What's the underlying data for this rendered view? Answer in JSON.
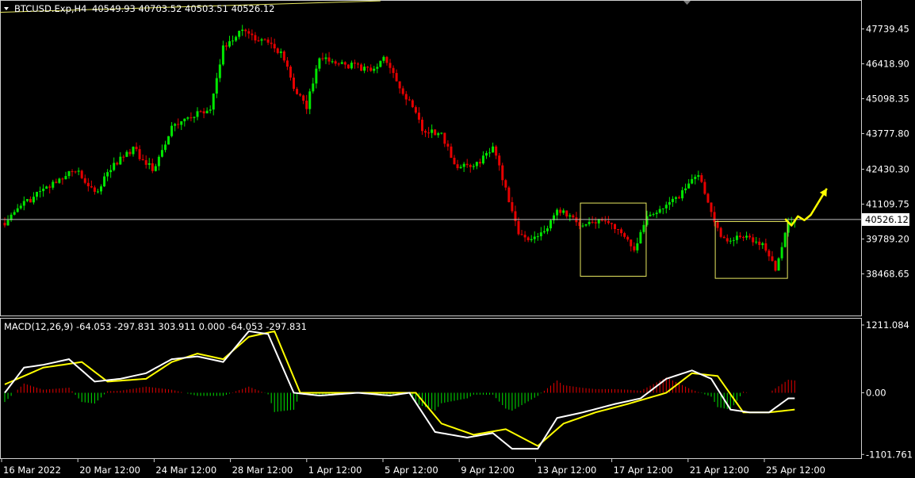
{
  "header": {
    "symbol_label": "BTCUSD.Exp,H4",
    "ohlc_label": "40549.93 40703.52 40503.51 40526.12"
  },
  "macd_header": {
    "label": "MACD(12,26,9) -64.053 -297.831 303.911 0.000 -64.053 -297.831"
  },
  "colors": {
    "background": "#000000",
    "bull_candle": "#00e600",
    "bear_candle": "#e60000",
    "macd_line": "#ffffff",
    "signal_line": "#ffff00",
    "trendline": "#e8e860",
    "current_price_line": "#c0c0c0",
    "box": "#e8e860",
    "arrow": "#ffff00"
  },
  "chart_data": [
    {
      "type": "candlestick",
      "timeframe": "H4",
      "y_ticks": [
        "47739.45",
        "46418.90",
        "45098.35",
        "43777.80",
        "42430.30",
        "41109.75",
        "39789.20",
        "38468.65"
      ],
      "y_tick_values": [
        47739.45,
        46418.9,
        45098.35,
        43777.8,
        42430.3,
        41109.75,
        39789.2,
        38468.65
      ],
      "current_price_label": "40526.12",
      "current_price": 40526.12,
      "ylim": [
        38000,
        48500
      ],
      "x_ticks": [
        "16 Mar 2022",
        "20 Mar 12:00",
        "24 Mar 12:00",
        "28 Mar 12:00",
        "1 Apr 12:00",
        "5 Apr 12:00",
        "9 Apr 12:00",
        "13 Apr 12:00",
        "17 Apr 12:00",
        "21 Apr 12:00",
        "25 Apr 12:00"
      ],
      "anchors": [
        [
          0,
          40400
        ],
        [
          4,
          40900
        ],
        [
          10,
          41500
        ],
        [
          16,
          42000
        ],
        [
          22,
          42400
        ],
        [
          28,
          41500
        ],
        [
          34,
          42600
        ],
        [
          40,
          43200
        ],
        [
          46,
          42400
        ],
        [
          52,
          44000
        ],
        [
          58,
          44400
        ],
        [
          64,
          44700
        ],
        [
          68,
          47000
        ],
        [
          74,
          47700
        ],
        [
          80,
          47300
        ],
        [
          86,
          46800
        ],
        [
          90,
          45600
        ],
        [
          94,
          44800
        ],
        [
          98,
          46600
        ],
        [
          104,
          46400
        ],
        [
          110,
          46300
        ],
        [
          114,
          46100
        ],
        [
          118,
          46700
        ],
        [
          122,
          45700
        ],
        [
          126,
          45000
        ],
        [
          130,
          43900
        ],
        [
          136,
          43800
        ],
        [
          140,
          42600
        ],
        [
          144,
          42500
        ],
        [
          148,
          42700
        ],
        [
          152,
          43200
        ],
        [
          156,
          41700
        ],
        [
          160,
          40000
        ],
        [
          164,
          39700
        ],
        [
          168,
          40000
        ],
        [
          172,
          41000
        ],
        [
          176,
          40600
        ],
        [
          180,
          40200
        ],
        [
          184,
          40500
        ],
        [
          188,
          40300
        ],
        [
          192,
          40100
        ],
        [
          196,
          39400
        ],
        [
          200,
          40600
        ],
        [
          204,
          40900
        ],
        [
          208,
          41200
        ],
        [
          212,
          41700
        ],
        [
          216,
          42300
        ],
        [
          220,
          40700
        ],
        [
          224,
          39700
        ],
        [
          228,
          39900
        ],
        [
          232,
          39800
        ],
        [
          236,
          39600
        ],
        [
          240,
          38700
        ],
        [
          244,
          40400
        ],
        [
          246,
          40526
        ]
      ]
    },
    {
      "type": "macd",
      "params": "12,26,9",
      "y_ticks": [
        "1211.084",
        "0.00",
        "-1101.761"
      ],
      "y_tick_values": [
        1211.084,
        0,
        -1101.761
      ],
      "ylim": [
        -1101.761,
        1211.084
      ],
      "macd_line_anchors": [
        [
          0,
          0
        ],
        [
          6,
          450
        ],
        [
          12,
          500
        ],
        [
          20,
          600
        ],
        [
          28,
          200
        ],
        [
          36,
          250
        ],
        [
          44,
          350
        ],
        [
          52,
          600
        ],
        [
          60,
          650
        ],
        [
          68,
          550
        ],
        [
          76,
          1100
        ],
        [
          82,
          1050
        ],
        [
          90,
          0
        ],
        [
          98,
          -50
        ],
        [
          110,
          0
        ],
        [
          120,
          -50
        ],
        [
          126,
          0
        ],
        [
          134,
          -700
        ],
        [
          144,
          -800
        ],
        [
          152,
          -720
        ],
        [
          158,
          -1000
        ],
        [
          166,
          -1000
        ],
        [
          172,
          -450
        ],
        [
          180,
          -350
        ],
        [
          190,
          -200
        ],
        [
          198,
          -100
        ],
        [
          206,
          250
        ],
        [
          214,
          400
        ],
        [
          220,
          250
        ],
        [
          226,
          -300
        ],
        [
          232,
          -350
        ],
        [
          238,
          -350
        ],
        [
          244,
          -100
        ]
      ],
      "signal_line_anchors": [
        [
          0,
          150
        ],
        [
          12,
          450
        ],
        [
          24,
          550
        ],
        [
          32,
          200
        ],
        [
          44,
          250
        ],
        [
          52,
          550
        ],
        [
          60,
          700
        ],
        [
          68,
          600
        ],
        [
          76,
          1000
        ],
        [
          84,
          1100
        ],
        [
          92,
          0
        ],
        [
          104,
          0
        ],
        [
          118,
          0
        ],
        [
          128,
          0
        ],
        [
          136,
          -550
        ],
        [
          146,
          -750
        ],
        [
          156,
          -650
        ],
        [
          166,
          -950
        ],
        [
          174,
          -550
        ],
        [
          184,
          -350
        ],
        [
          194,
          -200
        ],
        [
          206,
          0
        ],
        [
          214,
          350
        ],
        [
          222,
          300
        ],
        [
          230,
          -350
        ],
        [
          238,
          -350
        ],
        [
          246,
          -300
        ]
      ]
    }
  ],
  "annotations": {
    "boxes": [
      {
        "from_bar": 180,
        "to_bar": 199,
        "top": 41150,
        "bottom": 38380
      },
      {
        "from_bar": 222,
        "to_bar": 243,
        "top": 40450,
        "bottom": 38300
      }
    ],
    "trendline": [
      [
        0,
        48400
      ],
      [
        117,
        48800
      ]
    ],
    "forecast_arrow": [
      [
        243,
        40550
      ],
      [
        245,
        40300
      ],
      [
        247,
        40650
      ],
      [
        249,
        40500
      ],
      [
        251,
        40700
      ],
      [
        256,
        41700
      ]
    ]
  }
}
